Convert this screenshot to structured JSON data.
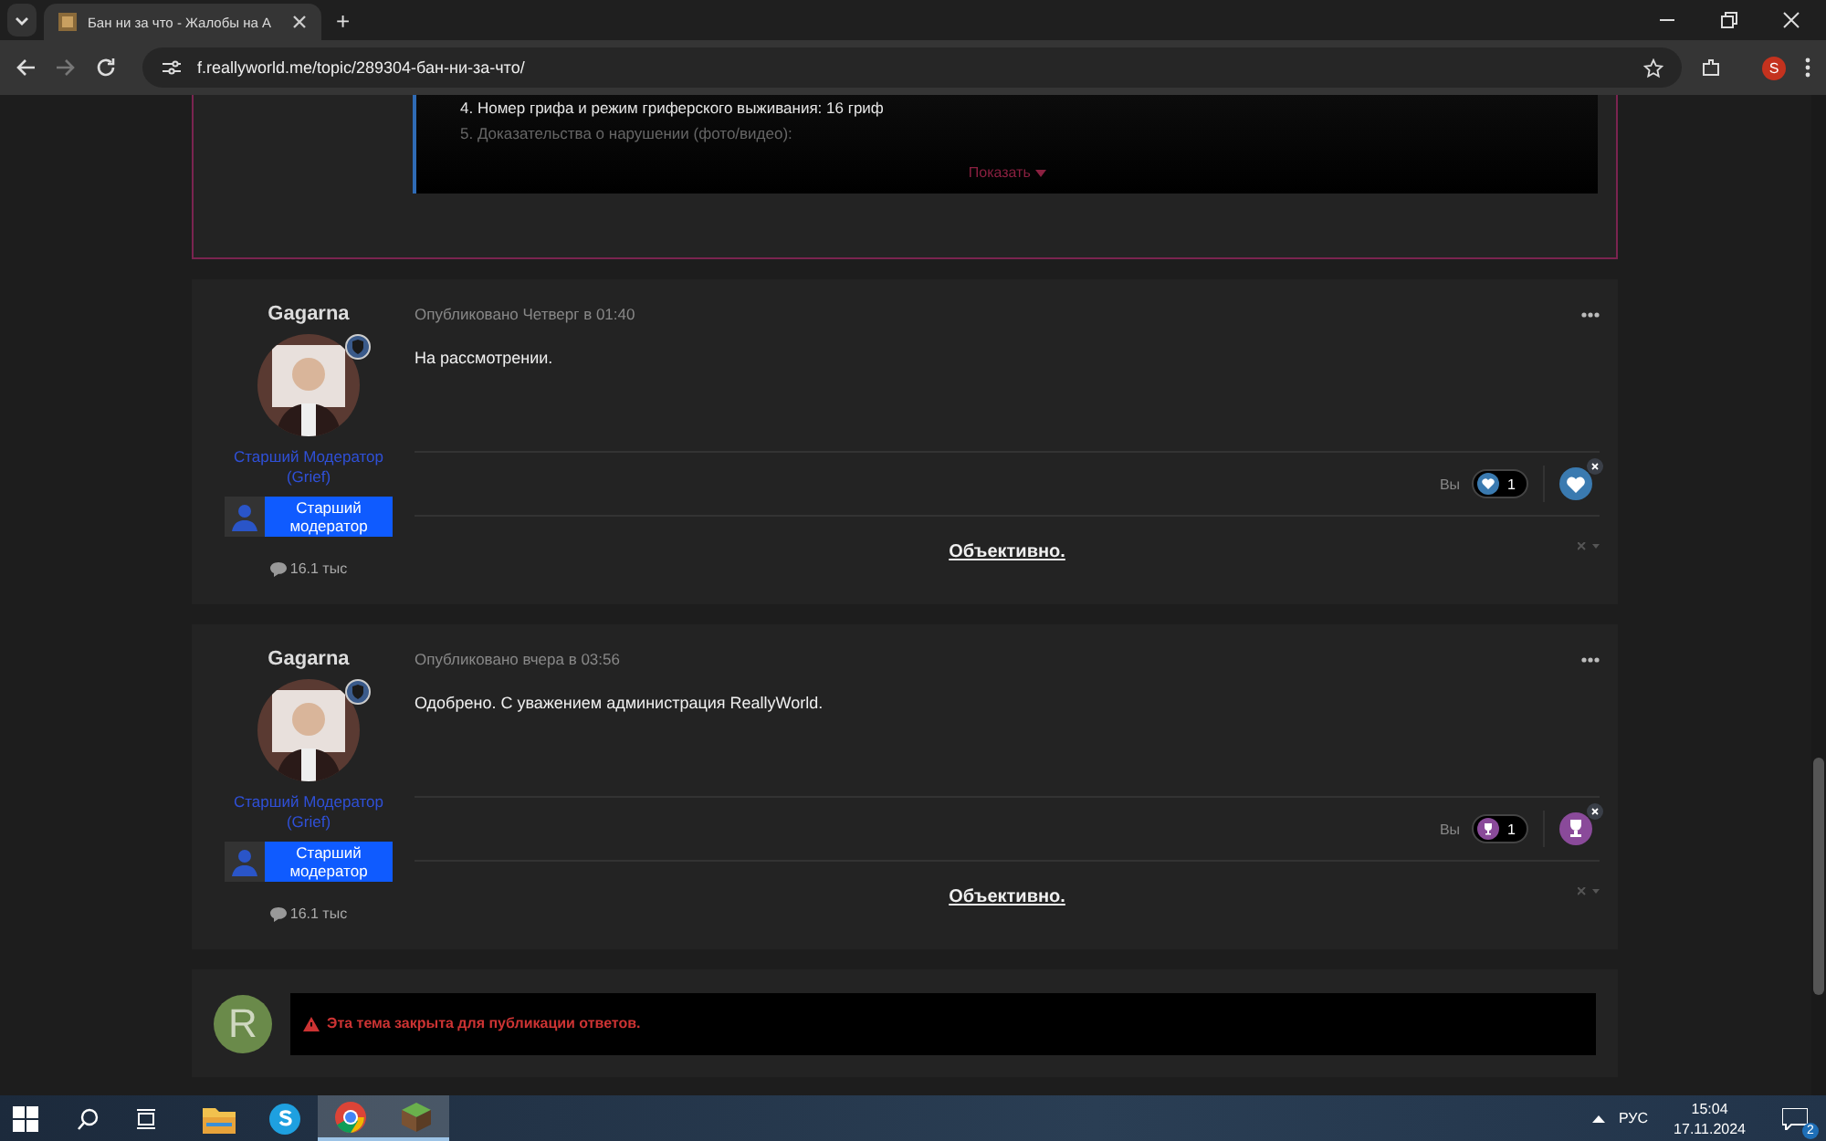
{
  "browser": {
    "tab_title": "Бан ни за что - Жалобы на А",
    "new_tab": "+",
    "url": "f.reallyworld.me/topic/289304-бан-ни-за-что/",
    "profile": "S"
  },
  "quote": {
    "lines": [
      "4. Номер грифа и режим гриферского выживания: 16 гриф",
      "5. Доказательства о нарушении (фото/видео):"
    ],
    "expand": "Показать"
  },
  "posts": [
    {
      "author": "Gagarna",
      "role": "Старший Модератор (Grief)",
      "badge": "Старший модератор",
      "count": "16.1 тыс",
      "published": "Опубликовано Четверг в 01:40",
      "body": "На рассмотрении.",
      "you": "Вы",
      "reaction": {
        "kind": "heart",
        "count": "1"
      },
      "signature": "Объективно."
    },
    {
      "author": "Gagarna",
      "role": "Старший Модератор (Grief)",
      "badge": "Старший модератор",
      "count": "16.1 тыс",
      "published": "Опубликовано вчера в 03:56",
      "body": "Одобрено. С уважением администрация ReallyWorld.",
      "you": "Вы",
      "reaction": {
        "kind": "trophy",
        "count": "1"
      },
      "signature": "Объективно."
    }
  ],
  "reply": {
    "avatar_letter": "R",
    "notice": "Эта тема закрыта для публикации ответов."
  },
  "taskbar": {
    "apps": [
      {
        "kind": "explorer",
        "active": false
      },
      {
        "kind": "skype",
        "active": false
      },
      {
        "kind": "chrome",
        "active": true
      },
      {
        "kind": "minecraft",
        "active": true
      }
    ],
    "lang": "РУС",
    "time": "15:04",
    "date": "17.11.2024",
    "notifications": "2"
  }
}
